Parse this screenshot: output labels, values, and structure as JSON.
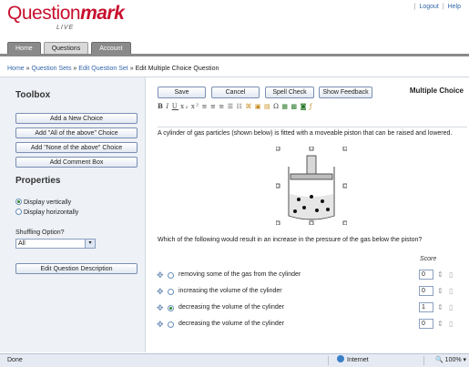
{
  "header": {
    "logo_main": "Question",
    "logo_bold": "mark",
    "logo_sub": "LIVE",
    "logout": "Logout",
    "help": "Help",
    "sep": "|"
  },
  "tabs": [
    {
      "label": "Home"
    },
    {
      "label": "Questions"
    },
    {
      "label": "Account"
    }
  ],
  "breadcrumb": {
    "home": "Home",
    "question_sets": "Question Sets",
    "edit_question_set": "Edit Question Set",
    "current": "Edit Multiple Choice Question",
    "sep": "»"
  },
  "sidebar": {
    "toolbox_title": "Toolbox",
    "add_choice": "Add a New Choice",
    "add_all": "Add \"All of the above\" Choice",
    "add_none": "Add \"None of the above\" Choice",
    "add_comment": "Add Comment Box",
    "properties_title": "Properties",
    "display_vertical": "Display vertically",
    "display_horizontal": "Display horizontally",
    "shuffling_label": "Shuffling Option?",
    "shuffling_value": "All",
    "edit_desc": "Edit Question Description"
  },
  "toolbar": {
    "save": "Save",
    "cancel": "Cancel",
    "spell_check": "Spell Check",
    "show_feedback": "Show Feedback",
    "type_title": "Multiple Choice"
  },
  "question": {
    "stem": "A cylinder of gas particles (shown below) is fitted with a moveable piston that can be raised and lowered.",
    "prompt": "Which of the following would result in an increase in the pressure of the gas below the piston?",
    "score_header": "Score",
    "choices": [
      {
        "text": "removing some of the gas from the cylinder",
        "score": "0",
        "selected": false
      },
      {
        "text": "increasing the volume of the cylinder",
        "score": "0",
        "selected": false
      },
      {
        "text": "decreasing the volume of the cylinder",
        "score": "1",
        "selected": true
      },
      {
        "text": "decreasing the volume of the cylinder",
        "score": "0",
        "selected": false
      }
    ]
  },
  "statusbar": {
    "done": "Done",
    "zone": "Internet",
    "zoom": "100%"
  },
  "colors": {
    "brand": "#c8102e",
    "link": "#3366aa",
    "sidebar_bg": "#eef1f6"
  }
}
